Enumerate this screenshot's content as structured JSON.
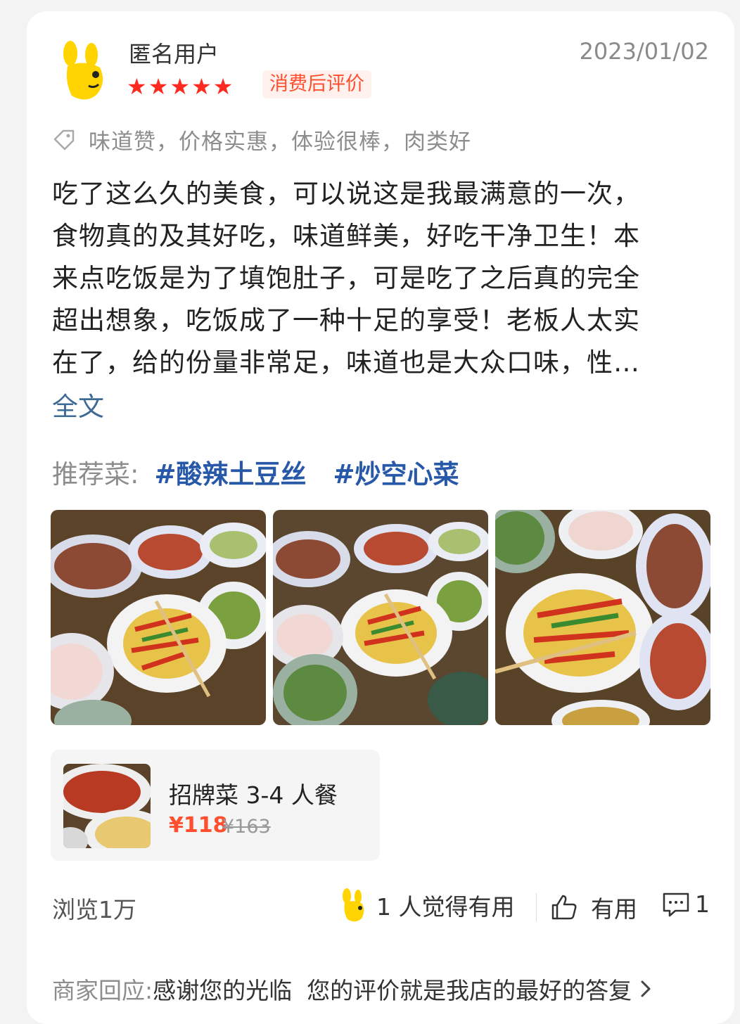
{
  "review": {
    "username": "匿名用户",
    "date": "2023/01/02",
    "rating": 5,
    "star_glyph": "★",
    "badge": "消费后评价",
    "tags": "味道赞，价格实惠，体验很棒，肉类好",
    "body_lines": [
      "吃了这么久的美食，可以说这是我最满意的一次，",
      "食物真的及其好吃，味道鲜美，好吃干净卫生！本",
      "来点吃饭是为了填饱肚子，可是吃了之后真的完全",
      "超出想象，吃饭成了一种十足的享受！老板人太实",
      "在了，给的份量非常足，味道也是大众口味，性…"
    ],
    "full_text_link": "全文",
    "recommend_label": "推荐菜:",
    "recommended": [
      "#酸辣土豆丝",
      "#炒空心菜"
    ]
  },
  "deal": {
    "title": "招牌菜 3-4 人餐",
    "price": "¥118",
    "original_price": "¥163"
  },
  "footer": {
    "views": "浏览1万",
    "useful_count": "1 人觉得有用",
    "like_label": "有用",
    "comment_count": "1"
  },
  "reply": {
    "label": "商家回应:",
    "text": "感谢您的光临  您的评价就是我店的最好的答复"
  },
  "colors": {
    "star": "#ff2a1f",
    "accent": "#ff4f2e",
    "link": "#2858a8",
    "muted": "#8d8d8d"
  },
  "icons": {
    "avatar": "yellow-mascot-icon",
    "tag": "tag-icon",
    "like": "thumbs-up-icon",
    "comment": "comment-icon",
    "reply_more": "chevron-right-icon"
  }
}
